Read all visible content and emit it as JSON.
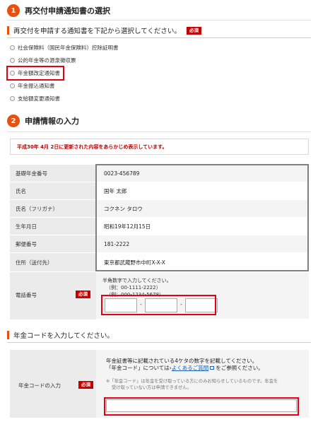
{
  "section1": {
    "number": "1",
    "title": "再交付申請通知書の選択"
  },
  "notice_select": {
    "text": "再交付を申請する通知書を下記から選択してください。",
    "required": "必須"
  },
  "options": [
    {
      "label": "社会保険料（国民年金保険料）控除証明書"
    },
    {
      "label": "公的年金等の源泉徴収票"
    },
    {
      "label": "年金額改定通知書"
    },
    {
      "label": "年金振込通知書"
    },
    {
      "label": "支給額変更通知書"
    }
  ],
  "section2": {
    "number": "2",
    "title": "申請情報の入力"
  },
  "update_notice": "平成30年 4月 2日に更新された内容をあらかじめ表示しています。",
  "info_rows": [
    {
      "label": "基礎年金番号",
      "value": "0023-456789"
    },
    {
      "label": "氏名",
      "value": "国年 太郎"
    },
    {
      "label": "氏名（フリガナ）",
      "value": "コクネン タロウ"
    },
    {
      "label": "生年月日",
      "value": "昭和19年12月15日"
    },
    {
      "label": "郵便番号",
      "value": "181-2222"
    },
    {
      "label": "住所（送付先）",
      "value": "東京都武蔵野市中町X-X-X"
    }
  ],
  "phone": {
    "label": "電話番号",
    "required": "必須",
    "help1": "半角数字で入力してください。",
    "help2": "（例：00-1111-2222）",
    "help3": "（例：000-1234-5678）",
    "dash": "-"
  },
  "pension_code": {
    "heading": "年金コードを入力してください。",
    "label": "年金コードの入力",
    "required": "必須",
    "help1": "年金証書等に記載されている4ケタの数字を記載してください。",
    "help2_pre": "「年金コード」については",
    "faq_link": "よくあるご質問",
    "help2_post": "をご参照ください。",
    "note1": "※「年金コード」は年金を受け取っている方にのみお知らせしているものです。年金を",
    "note2": "受け取っていない方は申請できません。"
  },
  "colors": {
    "accent": "#e8500f",
    "required_bg": "#c40000",
    "highlight": "#e60012"
  }
}
